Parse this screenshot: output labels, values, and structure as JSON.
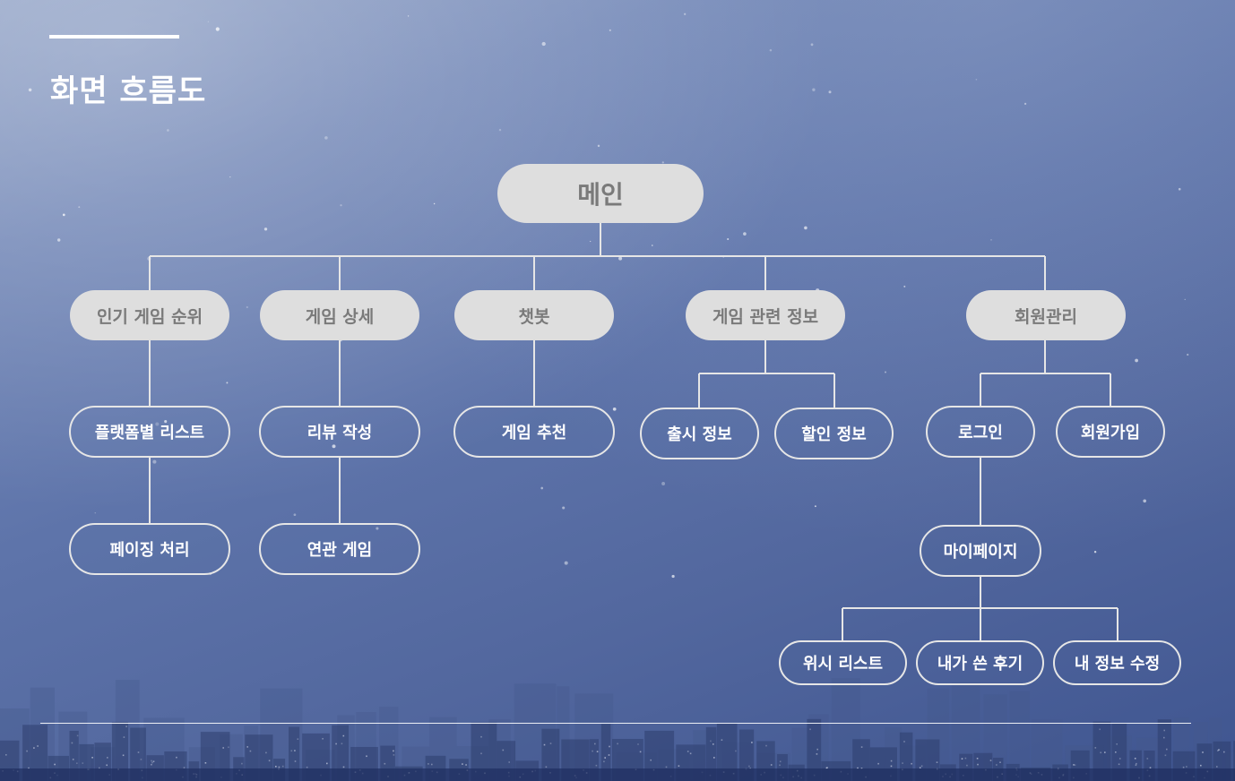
{
  "page": {
    "title": "화면 흐름도"
  },
  "diagram": {
    "root": {
      "label": "메인"
    },
    "categories": [
      {
        "label": "인기 게임 순위"
      },
      {
        "label": "게임 상세"
      },
      {
        "label": "챗봇"
      },
      {
        "label": "게임 관련 정보"
      },
      {
        "label": "회원관리"
      }
    ],
    "screens": {
      "platform_list": "플랫폼별 리스트",
      "paging": "페이징 처리",
      "write_review": "리뷰 작성",
      "related_games": "연관 게임",
      "game_recommend": "게임 추천",
      "release_info": "출시 정보",
      "discount_info": "할인 정보",
      "login": "로그인",
      "signup": "회원가입",
      "mypage": "마이페이지",
      "wishlist": "위시 리스트",
      "my_reviews": "내가 쓴 후기",
      "edit_profile": "내 정보 수정"
    }
  },
  "colors": {
    "node_fill": "#dedede",
    "node_fill_text": "#7a7a7a",
    "node_outline": "#e6e6e6",
    "connector": "#e6e6e6"
  }
}
